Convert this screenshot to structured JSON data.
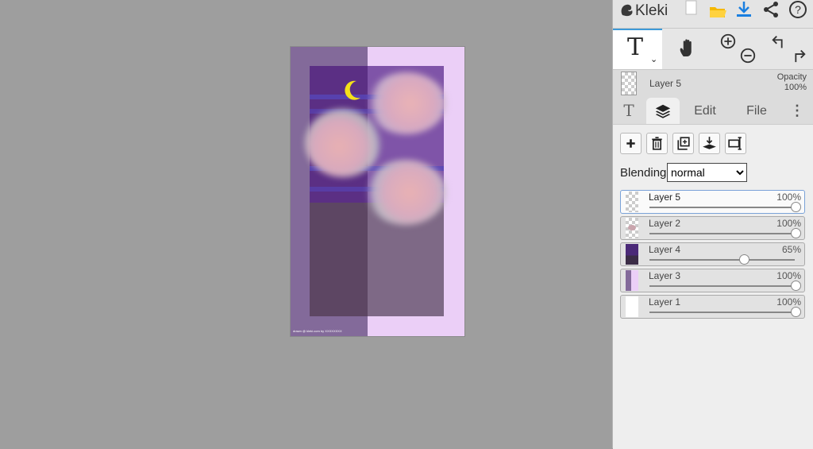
{
  "app": {
    "name": "Kleki"
  },
  "artwork": {
    "signature": "drawn @ kleki.com by XXXXXXXX"
  },
  "toolbar": {
    "active_tool_glyph": "T",
    "active_tool_chevron": "⌄",
    "hand_icon": "hand-icon",
    "zoom_icons": [
      "zoom-in-icon",
      "zoom-out-icon"
    ],
    "history_icons": [
      "undo-icon",
      "redo-icon"
    ]
  },
  "top_icons": [
    "new-file-icon",
    "open-folder-icon",
    "download-icon",
    "share-icon",
    "help-icon"
  ],
  "current_layer": {
    "name": "Layer 5",
    "opacity_label": "Opacity",
    "opacity_value": "100%"
  },
  "tabs": {
    "brush": "T",
    "edit": "Edit",
    "file": "File",
    "more": "⋮"
  },
  "layer_buttons": [
    "add-layer",
    "delete-layer",
    "duplicate-layer",
    "merge-down",
    "rename-layer"
  ],
  "blending": {
    "label": "Blending",
    "value": "normal",
    "options": [
      "normal"
    ]
  },
  "layers": [
    {
      "name": "Layer 5",
      "opacity": "100%",
      "level": 1.0,
      "active": true,
      "thumb": "checker"
    },
    {
      "name": "Layer 2",
      "opacity": "100%",
      "level": 1.0,
      "active": false,
      "thumb": "checker-dots"
    },
    {
      "name": "Layer 4",
      "opacity": "65%",
      "level": 0.65,
      "active": false,
      "thumb": "purple"
    },
    {
      "name": "Layer 3",
      "opacity": "100%",
      "level": 1.0,
      "active": false,
      "thumb": "split"
    },
    {
      "name": "Layer 1",
      "opacity": "100%",
      "level": 1.0,
      "active": false,
      "thumb": "white"
    }
  ],
  "colors": {
    "accent": "#3e9ad8",
    "open_folder": "#f5b800",
    "download": "#1a7fe0",
    "moon": "#f4e11a"
  }
}
